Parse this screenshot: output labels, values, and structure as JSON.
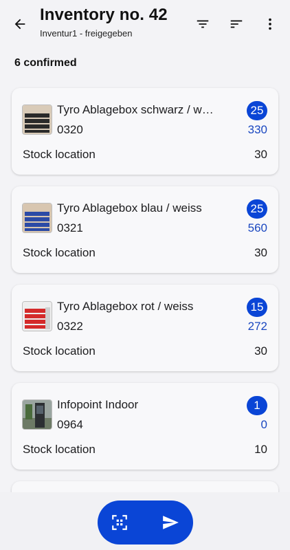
{
  "header": {
    "title": "Inventory no. 42",
    "subtitle": "Inventur1 - freigegeben",
    "icons": [
      "back-arrow-icon",
      "filter-icon",
      "sort-icon",
      "more-vert-icon"
    ]
  },
  "summary": "6 confirmed",
  "items": [
    {
      "name": "Tyro Ablagebox schwarz / w…",
      "code": "0320",
      "badge": "25",
      "quantity": "330",
      "location_label": "Stock location",
      "location_value": "30",
      "thumb_color": "#333333"
    },
    {
      "name": "Tyro Ablagebox blau / weiss",
      "code": "0321",
      "badge": "25",
      "quantity": "560",
      "location_label": "Stock location",
      "location_value": "30",
      "thumb_color": "#2b4aa6"
    },
    {
      "name": "Tyro Ablagebox rot / weiss",
      "code": "0322",
      "badge": "15",
      "quantity": "272",
      "location_label": "Stock location",
      "location_value": "30",
      "thumb_color": "#d42a2a"
    },
    {
      "name": "Infopoint Indoor",
      "code": "0964",
      "badge": "1",
      "quantity": "0",
      "location_label": "Stock location",
      "location_value": "10",
      "thumb_color": "#4a6b3c"
    }
  ],
  "fab": {
    "icons": [
      "qr-scan-icon",
      "send-icon"
    ]
  },
  "colors": {
    "accent": "#0a45d6",
    "quantity_text": "#1a47c0",
    "background": "#f3f3f6",
    "card": "#f8f8fa"
  }
}
